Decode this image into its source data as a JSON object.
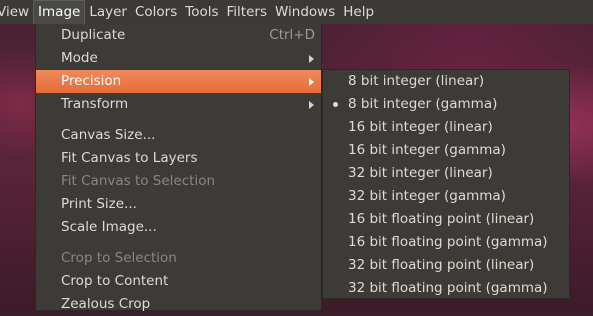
{
  "menubar": {
    "items": [
      "View",
      "Image",
      "Layer",
      "Colors",
      "Tools",
      "Filters",
      "Windows",
      "Help"
    ]
  },
  "image_menu": {
    "duplicate": {
      "label": "Duplicate",
      "shortcut": "Ctrl+D"
    },
    "mode": {
      "label": "Mode"
    },
    "precision": {
      "label": "Precision"
    },
    "transform": {
      "label": "Transform"
    },
    "canvas_size": {
      "label": "Canvas Size..."
    },
    "fit_canvas_to_layers": {
      "label": "Fit Canvas to Layers"
    },
    "fit_canvas_to_selection": {
      "label": "Fit Canvas to Selection"
    },
    "print_size": {
      "label": "Print Size..."
    },
    "scale_image": {
      "label": "Scale Image..."
    },
    "crop_to_selection": {
      "label": "Crop to Selection"
    },
    "crop_to_content": {
      "label": "Crop to Content"
    },
    "zealous_crop": {
      "label": "Zealous Crop"
    }
  },
  "precision_submenu": {
    "selected": "8 bit integer (gamma)",
    "items": [
      "8 bit integer (linear)",
      "8 bit integer (gamma)",
      "16 bit integer (linear)",
      "16 bit integer (gamma)",
      "32 bit integer (linear)",
      "32 bit integer (gamma)",
      "16 bit floating point (linear)",
      "16 bit floating point (gamma)",
      "32 bit floating point (linear)",
      "32 bit floating point (gamma)"
    ]
  },
  "colors": {
    "menubar_bg": "#3b3a36",
    "menu_bg": "#3c3b37",
    "highlight": "#e46d36",
    "text": "#dfdbd2",
    "disabled_text": "#8a8780"
  }
}
